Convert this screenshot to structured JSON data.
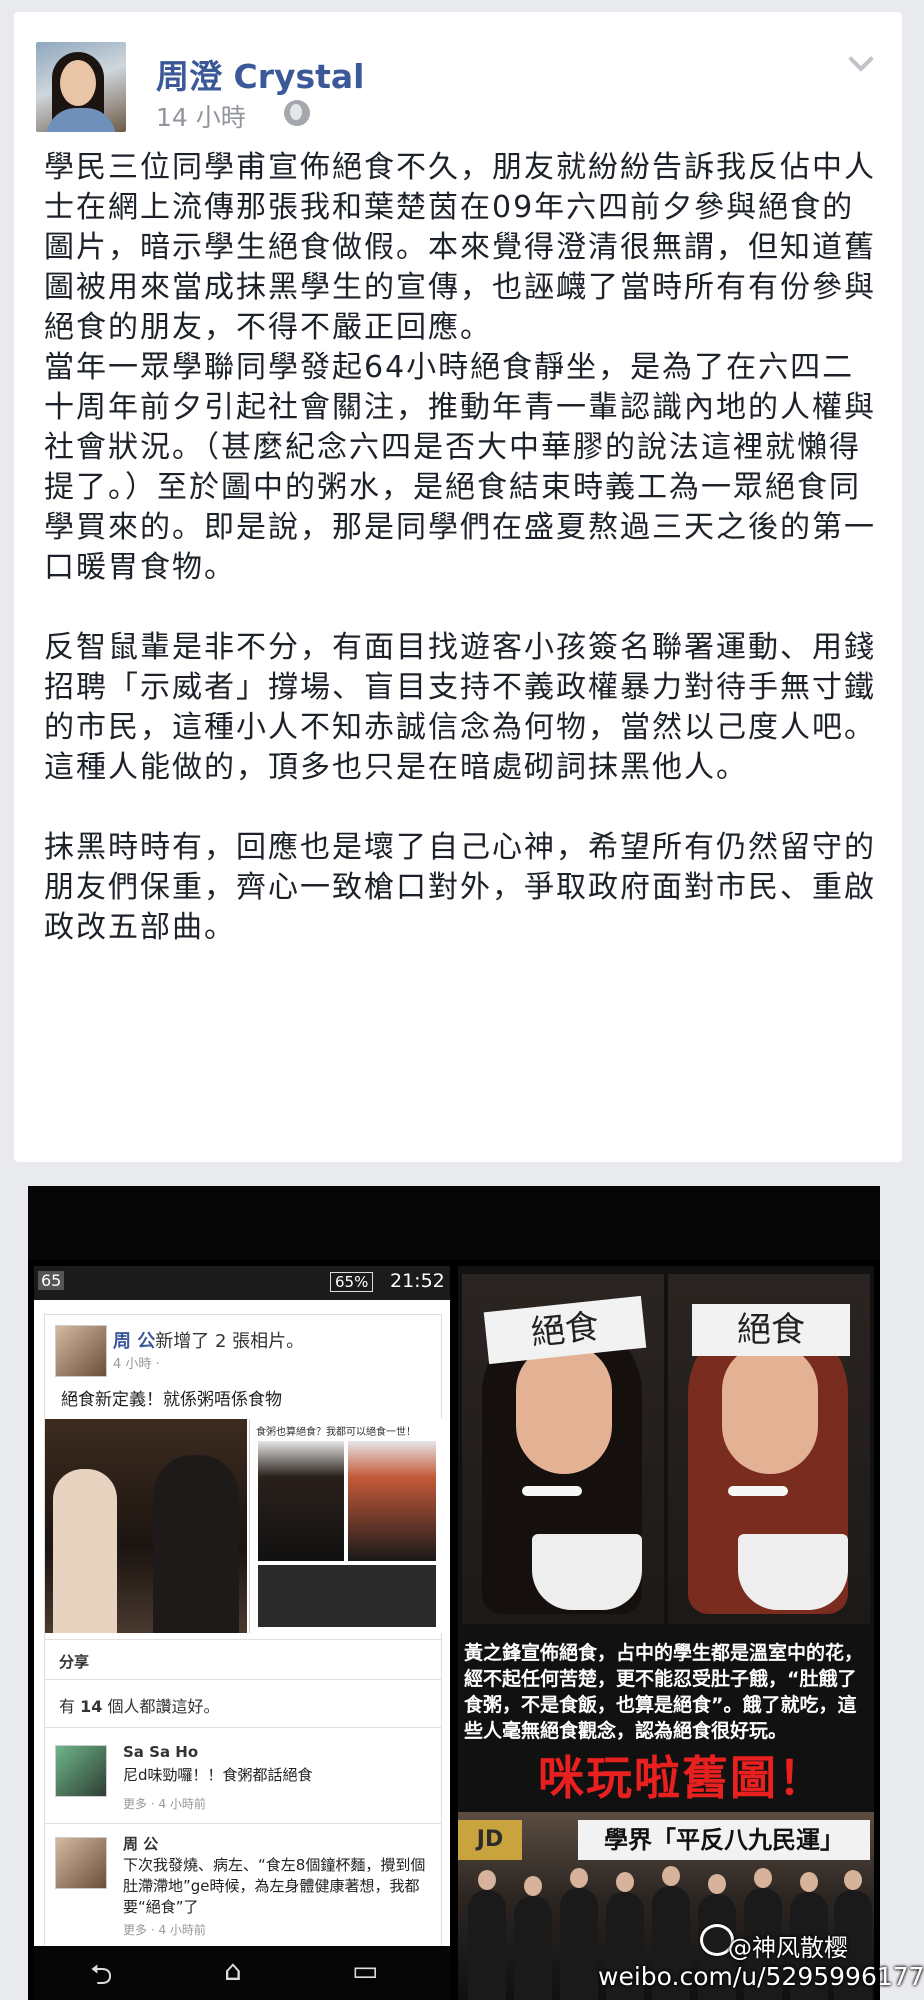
{
  "post": {
    "author": "周澄 Crystal",
    "time": "14 小時",
    "privacy_icon": "globe-icon",
    "menu_icon": "chevron-down-icon",
    "text": "學民三位同學甫宣佈絕食不久，朋友就紛紛告訴我反佔中人士在網上流傳那張我和葉楚茵在09年六四前夕參與絕食的圖片，暗示學生絕食做假。本來覺得澄清很無謂，但知道舊圖被用來當成抹黑學生的宣傳，也誣衊了當時所有有份參與絕食的朋友，不得不嚴正回應。\n當年一眾學聯同學發起64小時絕食靜坐，是為了在六四二十周年前夕引起社會關注，推動年青一輩認識內地的人權與社會狀況。（甚麼紀念六四是否大中華膠的說法這裡就懶得提了。）至於圖中的粥水，是絕食結束時義工為一眾絕食同學買來的。即是說，那是同學們在盛夏熬過三天之後的第一口暖胃食物。\n\n反智鼠輩是非不分，有面目找遊客小孩簽名聯署運動、用錢招聘「示威者」撐場、盲目支持不義政權暴力對待手無寸鐵的市民，這種小人不知赤誠信念為何物，當然以己度人吧。這種人能做的，頂多也只是在暗處砌詞抹黑他人。\n\n抹黑時時有，回應也是壞了自己心神，希望所有仍然留守的朋友們保重，齊心一致槍口對外，爭取政府面對市民、重啟政改五部曲。"
  },
  "screenshot": {
    "status": {
      "signal": "65",
      "battery": "65%",
      "clock": "21:52"
    },
    "fb_post": {
      "name": "周 公",
      "added": "新增了 2 張相片。",
      "time": "4 小時 ·",
      "text": "絕食新定義！就係粥唔係食物",
      "photo_caption": "食粥也算絕食？我都可以絕食一世！",
      "share": "分享",
      "likes_prefix": "有",
      "likes_count": "14",
      "likes_suffix": "個人都讚這好。"
    },
    "comments": [
      {
        "name": "Sa Sa Ho",
        "text": "尼d味勁囉！！食粥都話絕食",
        "meta": "更多 · 4 小時前"
      },
      {
        "name": "周 公",
        "text": "下次我發燒、病左、“食左8個鐘杯麵，攪到個肚滯滯地”ge時候，為左身體健康著想，我都要“絕食”了",
        "meta": "更多 · 4 小時前"
      }
    ],
    "nav": {
      "back": "⮌",
      "home": "⌂",
      "recent": "▭"
    }
  },
  "collage": {
    "headband": "絕食",
    "caption": "黃之鋒宣佈絕食，占中的學生都是溫室中的花，經不起任何苦楚，更不能忍受肚子餓，“肚餓了食粥，不是食飯，也算是絕食”。餓了就吃，這些人毫無絕食觀念，認為絕食很好玩。",
    "red_text": "咪玩啦舊圖！",
    "sign": "學界「平反八九民運」",
    "sign2": "JD"
  },
  "watermark": {
    "handle": "@神风散樱",
    "url": "weibo.com/u/5295996177"
  }
}
